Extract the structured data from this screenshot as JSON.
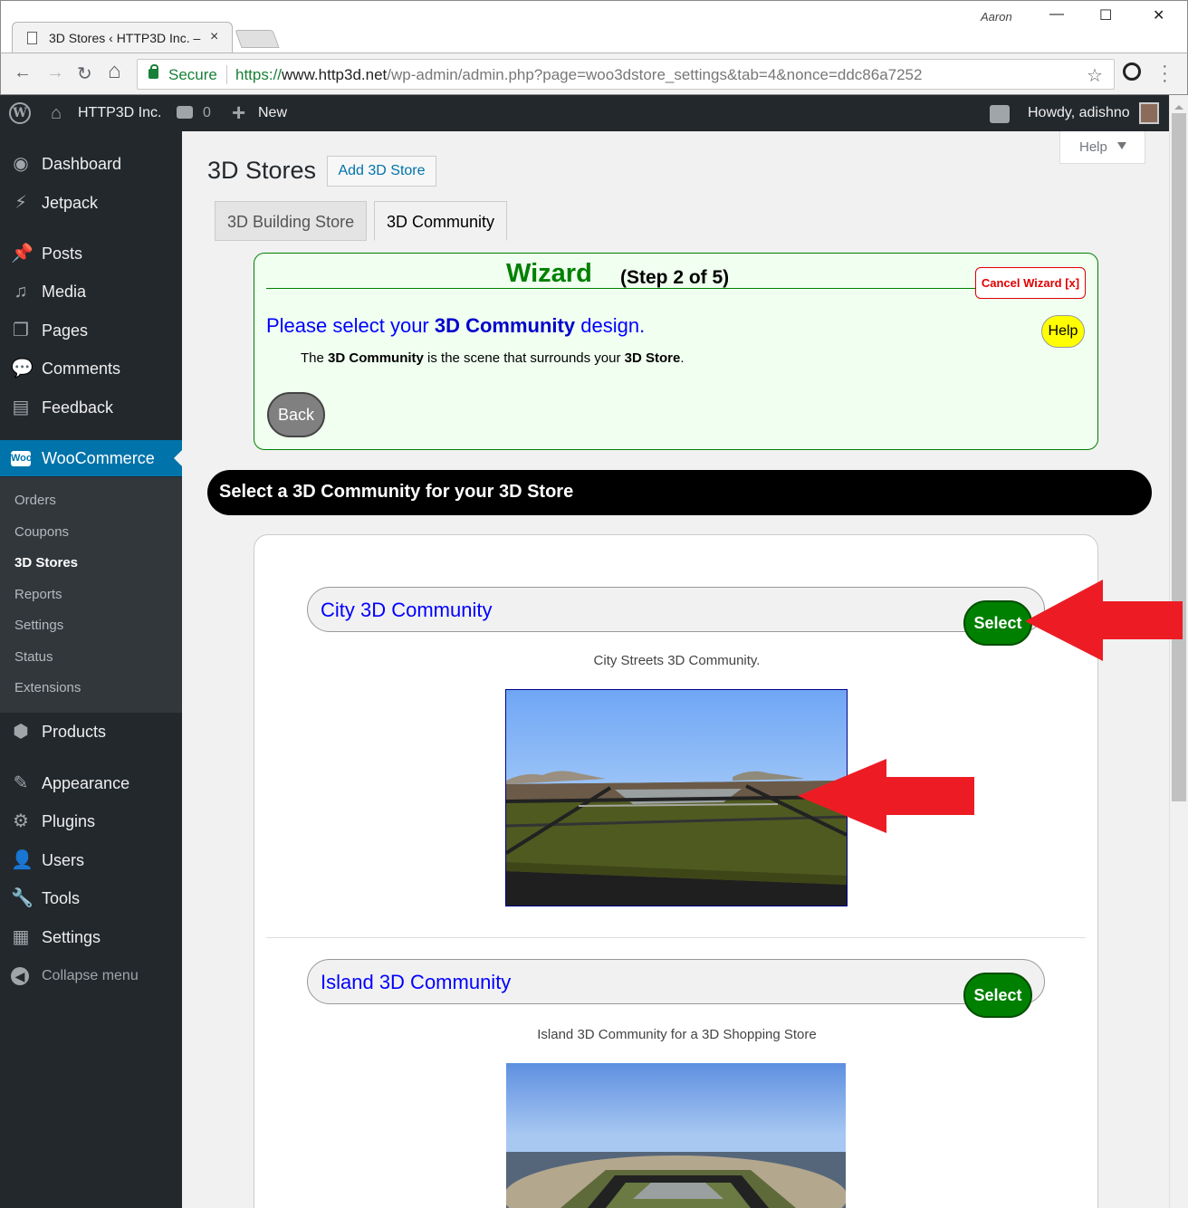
{
  "browser": {
    "tab_title": "3D Stores ‹ HTTP3D Inc. –",
    "tab_close": "×",
    "window_user": "Aaron",
    "minimize": "—",
    "maximize": "☐",
    "close": "✕",
    "secure_label": "Secure",
    "url_scheme": "https://",
    "url_host": "www.http3d.net",
    "url_path": "/wp-admin/admin.php?page=woo3dstore_settings&tab=4&nonce=ddc86a7252",
    "back": "←",
    "forward": "→",
    "reload": "↻",
    "home": "⌂",
    "star": "☆"
  },
  "adminbar": {
    "site_name": "HTTP3D Inc.",
    "comments_count": "0",
    "new_label": "New",
    "howdy": "Howdy, adishno"
  },
  "sidebar": {
    "items": [
      {
        "label": "Dashboard",
        "icon": "◉"
      },
      {
        "label": "Jetpack",
        "icon": "⚡"
      },
      {
        "label": "Posts",
        "icon": "📌"
      },
      {
        "label": "Media",
        "icon": "♫"
      },
      {
        "label": "Pages",
        "icon": "❐"
      },
      {
        "label": "Comments",
        "icon": "💬"
      },
      {
        "label": "Feedback",
        "icon": "▤"
      },
      {
        "label": "WooCommerce",
        "icon": "W"
      },
      {
        "label": "Products",
        "icon": "⬢"
      },
      {
        "label": "Appearance",
        "icon": "✎"
      },
      {
        "label": "Plugins",
        "icon": "⚙"
      },
      {
        "label": "Users",
        "icon": "👤"
      },
      {
        "label": "Tools",
        "icon": "🔧"
      },
      {
        "label": "Settings",
        "icon": "▦"
      },
      {
        "label": "Collapse menu",
        "icon": "◀"
      }
    ],
    "woo_submenu": [
      "Orders",
      "Coupons",
      "3D Stores",
      "Reports",
      "Settings",
      "Status",
      "Extensions"
    ]
  },
  "main": {
    "help_tab": "Help",
    "page_title": "3D Stores",
    "add_button": "Add 3D Store",
    "tabs": [
      "3D Building Store",
      "3D Community"
    ],
    "wizard": {
      "title": "Wizard",
      "step": "(Step 2 of 5)",
      "cancel": "Cancel Wizard [x]",
      "question_prefix": "Please select your ",
      "question_bold": "3D Community",
      "question_suffix": " design.",
      "help": "Help",
      "desc_1": "The ",
      "desc_bold_1": "3D Community",
      "desc_2": " is the scene that surrounds your ",
      "desc_bold_2": "3D Store",
      "desc_3": ".",
      "back": "Back"
    },
    "section_title": "Select a 3D Community for your 3D Store",
    "communities": [
      {
        "title": "City 3D Community",
        "select": "Select",
        "description": "City Streets 3D Community."
      },
      {
        "title": "Island 3D Community",
        "select": "Select",
        "description": "Island 3D Community for a 3D Shopping Store"
      }
    ]
  },
  "colors": {
    "wp_dark": "#23282d",
    "wp_blue": "#0073aa",
    "wizard_green": "#008000",
    "arrow_red": "#ed1c24",
    "link_blue": "#0000ff"
  }
}
